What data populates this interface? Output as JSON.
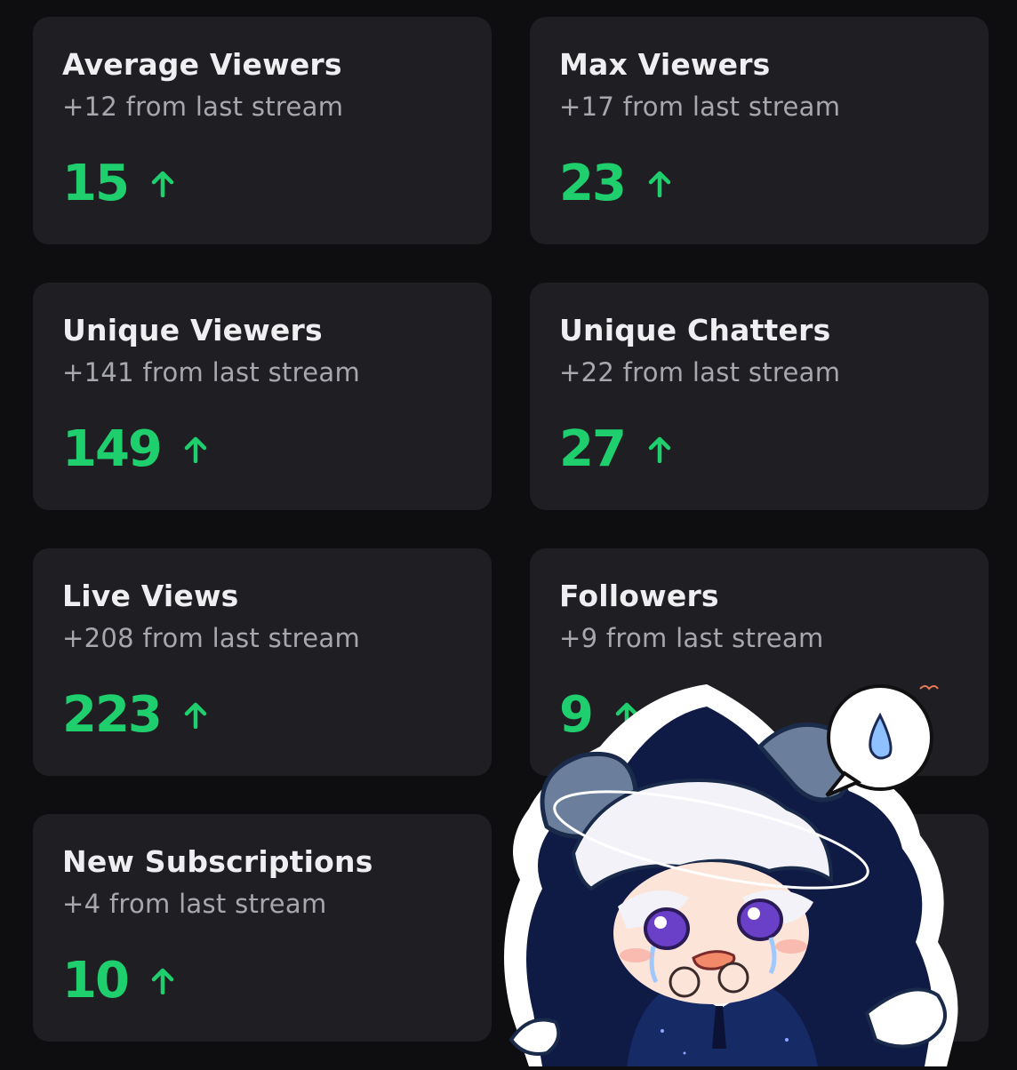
{
  "cards": [
    {
      "title": "Average Viewers",
      "delta": "+12 from last stream",
      "value": "15",
      "trend": "up"
    },
    {
      "title": "Max Viewers",
      "delta": "+17 from last stream",
      "value": "23",
      "trend": "up"
    },
    {
      "title": "Unique Viewers",
      "delta": "+141 from last stream",
      "value": "149",
      "trend": "up"
    },
    {
      "title": "Unique Chatters",
      "delta": "+22 from last stream",
      "value": "27",
      "trend": "up"
    },
    {
      "title": "Live Views",
      "delta": "+208 from last stream",
      "value": "223",
      "trend": "up"
    },
    {
      "title": "Followers",
      "delta": "+9 from last stream",
      "value": "9",
      "trend": "up"
    },
    {
      "title": "New Subscriptions",
      "delta": "+4 from last stream",
      "value": "10",
      "trend": "up"
    }
  ],
  "colors": {
    "background": "#0e0e10",
    "card": "#1f1f23",
    "positive": "#1fcf6e",
    "title": "#efeff1",
    "subtle": "#a7a7ae"
  },
  "icons": {
    "trend_up": "arrow-up-icon",
    "sticker": "chibi-character-sticker"
  }
}
